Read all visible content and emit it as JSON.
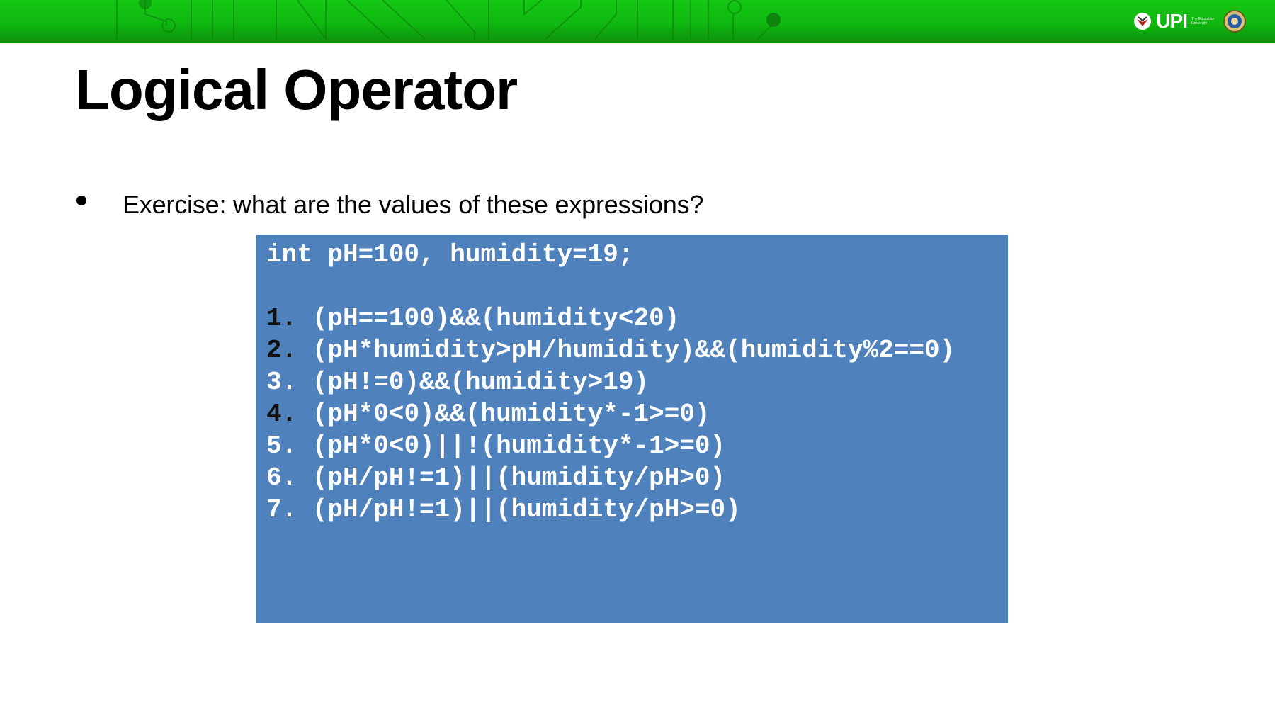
{
  "header": {
    "logo_text": "UPI",
    "logo_tagline": "The Education University"
  },
  "slide": {
    "title": "Logical Operator",
    "bullet": "Exercise: what are the values of these expressions?"
  },
  "code": {
    "declaration": "int pH=100, humidity=19;",
    "items": [
      {
        "number": "1.",
        "expr": "(pH==100)&&(humidity<20)"
      },
      {
        "number": "2.",
        "expr": "(pH*humidity>pH/humidity)&&(humidity%2==0)"
      },
      {
        "number": "3.",
        "expr": "(pH!=0)&&(humidity>19)"
      },
      {
        "number": "4.",
        "expr": "(pH*0<0)&&(humidity*-1>=0)"
      },
      {
        "number": "5.",
        "expr": "(pH*0<0)||!(humidity*-1>=0)"
      },
      {
        "number": "6.",
        "expr": "(pH/pH!=1)||(humidity/pH>0)"
      },
      {
        "number": "7.",
        "expr": "(pH/pH!=1)||(humidity/pH>=0)"
      }
    ]
  },
  "colors": {
    "header_green": "#10b810",
    "code_background": "#4f81bd",
    "code_text": "#ffffff"
  }
}
